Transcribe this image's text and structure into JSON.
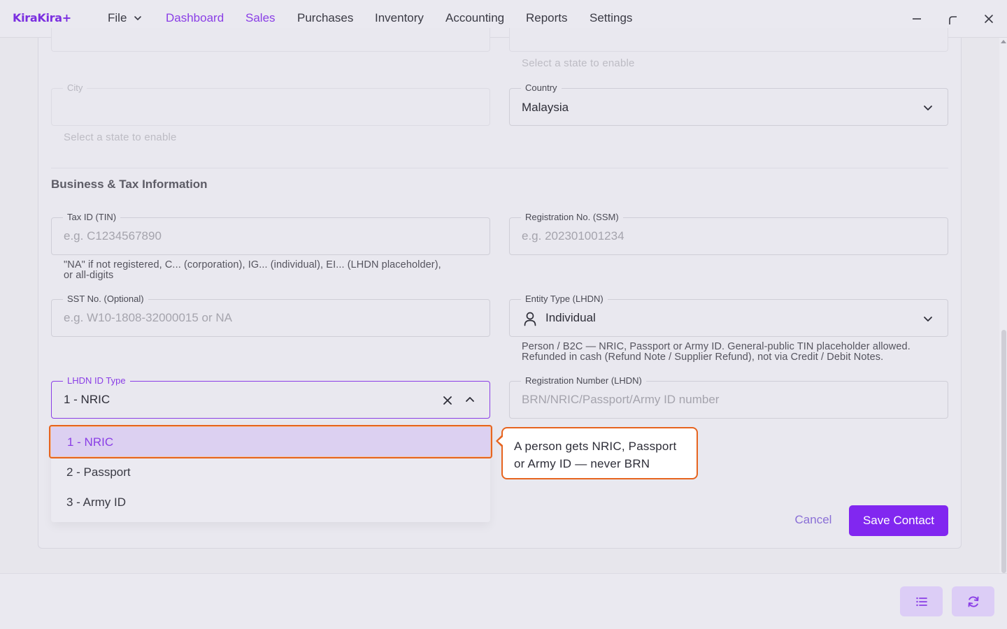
{
  "app": {
    "name": "KiraKira+"
  },
  "menu": {
    "file_label": "File",
    "nav": [
      "Dashboard",
      "Sales",
      "Purchases",
      "Inventory",
      "Accounting",
      "Reports",
      "Settings"
    ],
    "active": "Sales"
  },
  "address": {
    "state_helper": "Select a state to enable",
    "city_label": "City",
    "city_helper": "Select a state to enable",
    "country_label": "Country",
    "country_value": "Malaysia"
  },
  "business": {
    "section_title": "Business & Tax Information",
    "tin_label": "Tax ID (TIN)",
    "tin_placeholder": "e.g. C1234567890",
    "tin_helper_line1": "\"NA\" if not registered, C... (corporation), IG... (individual), EI... (LHDN placeholder),",
    "tin_helper_line2": "or all-digits",
    "ssm_label": "Registration No. (SSM)",
    "ssm_placeholder": "e.g. 202301001234",
    "sst_label": "SST No. (Optional)",
    "sst_placeholder": "e.g. W10-1808-32000015 or NA",
    "entity_label": "Entity Type (LHDN)",
    "entity_value": "Individual",
    "entity_helper_line1": "Person / B2C — NRIC, Passport or Army ID. General-public TIN placeholder allowed.",
    "entity_helper_line2": "Refunded in cash (Refund Note / Supplier Refund), not via Credit / Debit Notes.",
    "id_type_label": "LHDN ID Type",
    "id_type_value": "1 - NRIC",
    "id_type_options": [
      "1 - NRIC",
      "2 - Passport",
      "3 - Army ID"
    ],
    "reg_label": "Registration Number (LHDN)",
    "reg_placeholder": "BRN/NRIC/Passport/Army ID number"
  },
  "tooltip": {
    "line1": "A person gets NRIC, Passport",
    "line2": "or Army ID — never BRN"
  },
  "actions": {
    "cancel": "Cancel",
    "save": "Save Contact"
  },
  "icons": {
    "file_chevron": "chevron-down-icon",
    "minimize": "minimize-icon",
    "restore": "restore-icon",
    "close": "close-icon",
    "entity": "person-icon",
    "clear": "clear-icon",
    "list": "list-icon",
    "refresh": "refresh-icon"
  },
  "colors": {
    "accent": "#8127f0",
    "brand": "#7b2fe0",
    "highlight_border": "#e6641f",
    "selected_option_bg": "#dcd0f1"
  }
}
